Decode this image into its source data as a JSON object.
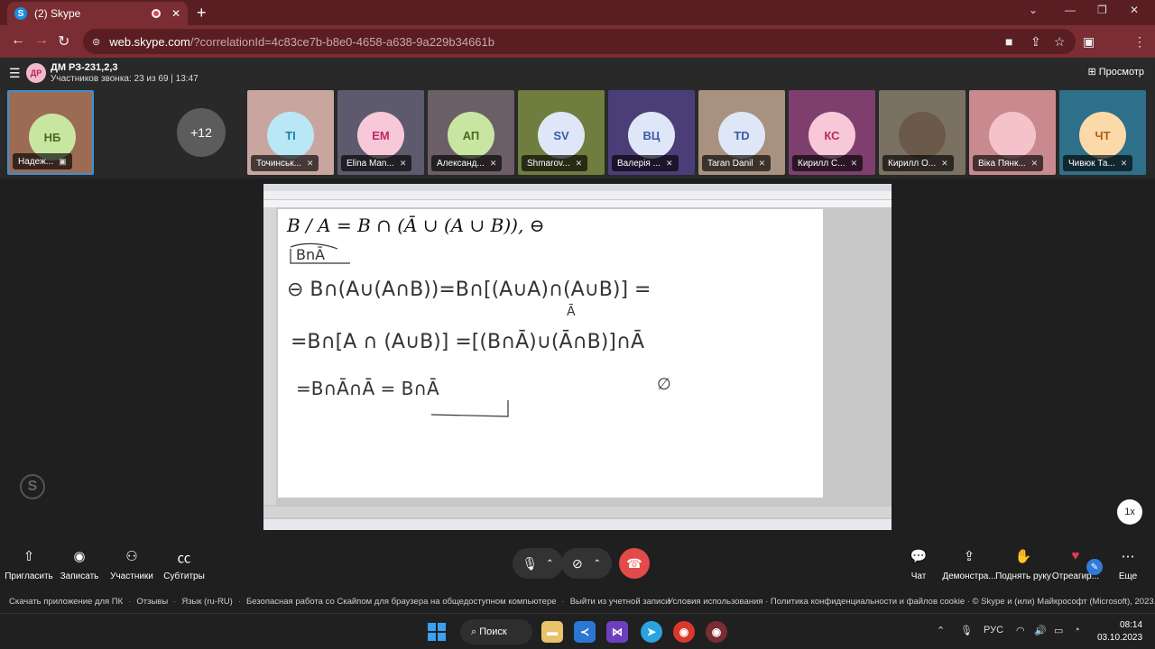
{
  "browser": {
    "tab_title": "(2) Skype",
    "favicon_letter": "S",
    "url_host": "web.skype.com",
    "url_path": "/?correlationId=4c83ce7b-b8e0-4658-a638-9a229b34661b"
  },
  "call": {
    "badge": "ДР",
    "title": "ДМ РЗ-231,2,3",
    "subtitle": "Участников звонка: 23 из 69 | 13:47",
    "view_label": "Просмотр",
    "more_count": "+12"
  },
  "participants": [
    {
      "initials": "НБ",
      "name": "Надеж...",
      "circle": "#c8e6a2",
      "text": "#4a6a1e",
      "bg": "#9c6b53"
    },
    {
      "initials": "ТІ",
      "name": "Точинськ...",
      "circle": "#b9e7f5",
      "text": "#1f7fa3",
      "bg": "#c9a5a0"
    },
    {
      "initials": "ЕМ",
      "name": "Elina Man...",
      "circle": "#f7c8d8",
      "text": "#b82a63",
      "bg": "#5d5a6e"
    },
    {
      "initials": "АП",
      "name": "Александ...",
      "circle": "#c8e6a2",
      "text": "#4a6a1e",
      "bg": "#6b5e66"
    },
    {
      "initials": "SV",
      "name": "Shmarov...",
      "circle": "#dfe6f7",
      "text": "#3b5ba3",
      "bg": "#6f7d3f"
    },
    {
      "initials": "ВЦ",
      "name": "Валерія ...",
      "circle": "#dfe6f7",
      "text": "#3b5ba3",
      "bg": "#4b3e78"
    },
    {
      "initials": "TD",
      "name": "Taran Danil",
      "circle": "#dfe6f7",
      "text": "#3b5ba3",
      "bg": "#a8917e"
    },
    {
      "initials": "КС",
      "name": "Кирилл С...",
      "circle": "#f7c8d8",
      "text": "#b82a63",
      "bg": "#7e3f6e"
    },
    {
      "initials": "",
      "name": "Кирилл О...",
      "circle": "#6b5a4a",
      "text": "#fff",
      "bg": "#7b7163"
    },
    {
      "initials": "",
      "name": "Віка Пянк...",
      "circle": "#f6c2c9",
      "text": "#fff",
      "bg": "#c98a8f"
    },
    {
      "initials": "ЧТ",
      "name": "Чивюк Та...",
      "circle": "#fbd9a8",
      "text": "#b35a12",
      "bg": "#2e6f8a"
    }
  ],
  "shared": {
    "formula": "B / A = B ∩ (Ā ∪ (A ∪ B)), ⊖"
  },
  "zoom": "1x",
  "controls": {
    "left": [
      {
        "label": "Пригласить",
        "icon": "share-icon"
      },
      {
        "label": "Записать",
        "icon": "record-icon"
      },
      {
        "label": "Участники",
        "icon": "people-icon"
      },
      {
        "label": "Субтитры",
        "icon": "captions-icon"
      }
    ],
    "right": [
      {
        "label": "Чат",
        "icon": "chat-icon"
      },
      {
        "label": "Демонстра...",
        "icon": "screen-share-icon"
      },
      {
        "label": "Поднять руку",
        "icon": "raise-hand-icon"
      },
      {
        "label": "Отреагир...",
        "icon": "heart-icon"
      },
      {
        "label": "Еще",
        "icon": "more-icon"
      }
    ]
  },
  "footer": {
    "links": [
      "Скачать приложение для ПК",
      "Отзывы",
      "Язык (ru-RU)",
      "Безопасная работа со Скайпом для браузера на общедоступном компьютере",
      "Выйти из учетной записи"
    ],
    "right": "Условия использования · Политика конфиденциальности и файлов cookie · © Skype и (или) Майкрософт (Microsoft), 2023."
  },
  "taskbar": {
    "search": "Поиск",
    "lang": "РУС",
    "time": "08:14",
    "date": "03.10.2023"
  },
  "colors": {
    "chrome_tab": "#5a1e22",
    "chrome_bar": "#7a2d33",
    "hangup": "#e34a4a"
  }
}
